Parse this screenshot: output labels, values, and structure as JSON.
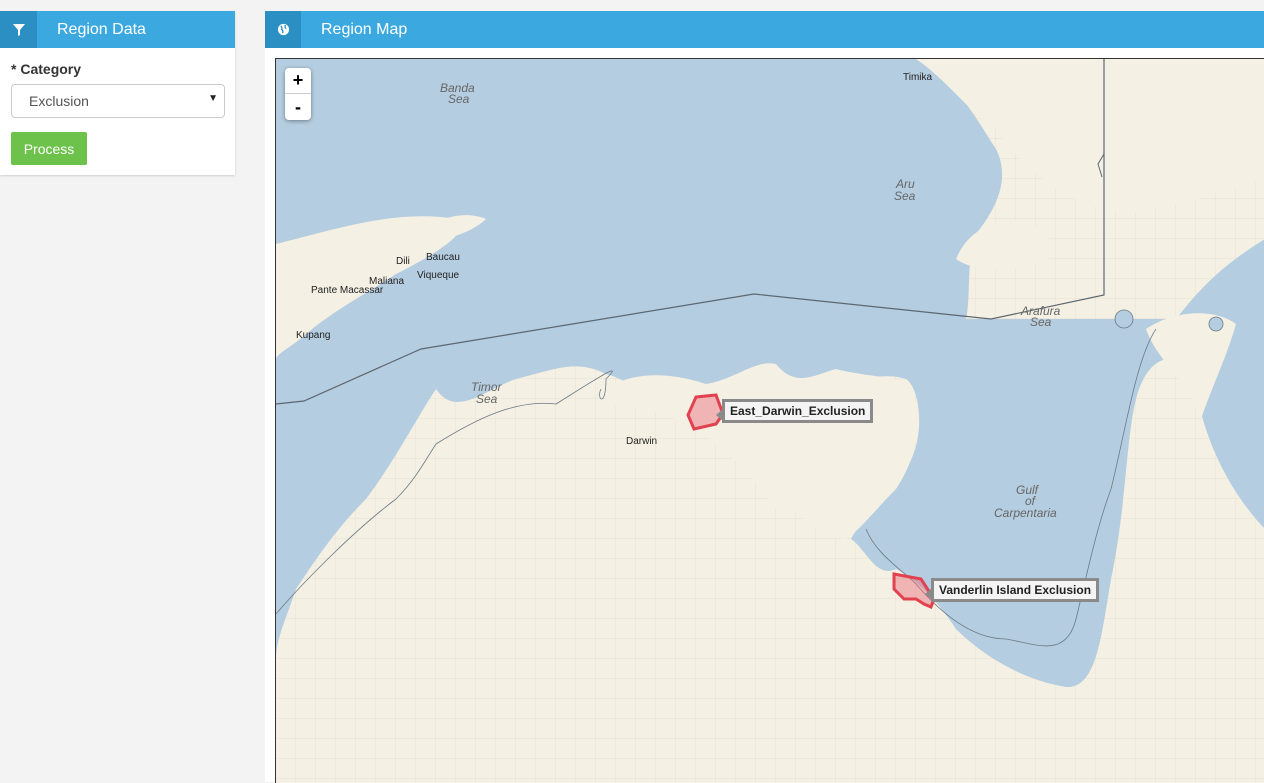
{
  "left_panel": {
    "title": "Region Data",
    "icon": "filter-icon",
    "category_required_mark": "*",
    "category_label": "Category",
    "category_value": "Exclusion",
    "process_label": "Process"
  },
  "map_panel": {
    "title": "Region Map",
    "icon": "globe-icon",
    "zoom_in": "+",
    "zoom_out": "-",
    "places": {
      "timika": "Timika",
      "dili": "Dili",
      "baucau": "Baucau",
      "maliana": "Maliana",
      "viqueque": "Viqueque",
      "pante_macassar": "Pante Macassar",
      "kupang": "Kupang",
      "darwin": "Darwin"
    },
    "seas": {
      "banda_1": "Banda",
      "banda_2": "Sea",
      "aru_1": "Aru",
      "aru_2": "Sea",
      "arafura_1": "Arafura",
      "arafura_2": "Sea",
      "timor_1": "Timor",
      "timor_2": "Sea",
      "gulf_1": "Gulf",
      "gulf_2": "of",
      "gulf_3": "Carpentaria"
    },
    "regions": [
      {
        "label": "East_Darwin_Exclusion"
      },
      {
        "label": "Vanderlin Island Exclusion"
      }
    ]
  },
  "colors": {
    "header": "#3ba9e0",
    "header_icon_bg": "#2b8fc4",
    "process_button": "#6cc24a",
    "water": "#b5cde0",
    "land": "#f5f0e4",
    "region_fill": "#e86a78"
  }
}
